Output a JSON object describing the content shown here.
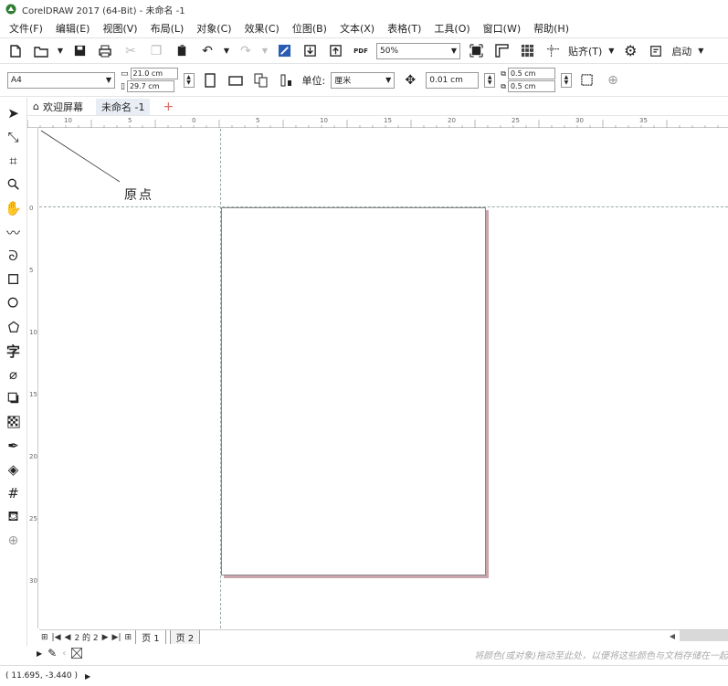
{
  "window": {
    "title": "CorelDRAW 2017 (64-Bit) - 未命名 -1"
  },
  "menu": [
    {
      "id": "file",
      "label": "文件(F)"
    },
    {
      "id": "edit",
      "label": "编辑(E)"
    },
    {
      "id": "view",
      "label": "视图(V)"
    },
    {
      "id": "layout",
      "label": "布局(L)"
    },
    {
      "id": "object",
      "label": "对象(C)"
    },
    {
      "id": "effects",
      "label": "效果(C)"
    },
    {
      "id": "bitmaps",
      "label": "位图(B)"
    },
    {
      "id": "text",
      "label": "文本(X)"
    },
    {
      "id": "table",
      "label": "表格(T)"
    },
    {
      "id": "tools",
      "label": "工具(O)"
    },
    {
      "id": "window",
      "label": "窗口(W)"
    },
    {
      "id": "help",
      "label": "帮助(H)"
    }
  ],
  "toolbar": {
    "zoom_value": "50%",
    "snap_label": "贴齐(T)",
    "launch_label": "启动",
    "pdf_label": "PDF"
  },
  "property_bar": {
    "page_size": "A4",
    "width": "21.0 cm",
    "height": "29.7 cm",
    "units_label": "单位:",
    "units_value": "厘米",
    "nudge": "0.01 cm",
    "dup_x": "0.5 cm",
    "dup_y": "0.5 cm"
  },
  "doc_tabs": {
    "welcome": "欢迎屏幕",
    "current": "未命名 -1"
  },
  "ruler_h_labels": [
    "10",
    "5",
    "0",
    "5",
    "10",
    "15",
    "20",
    "25",
    "30",
    "35"
  ],
  "ruler_v_labels": [
    "0",
    "5",
    "10",
    "15",
    "20",
    "25",
    "30"
  ],
  "annotation": {
    "origin_label": "原点"
  },
  "page_nav": {
    "position": "2 的 2",
    "pages": [
      "页 1",
      "页 2"
    ]
  },
  "color_hint": "将颜色(或对象)拖动至此处，以便将这些颜色与文档存储在一起",
  "status": {
    "coords": "( 11.695, -3.440 )"
  }
}
